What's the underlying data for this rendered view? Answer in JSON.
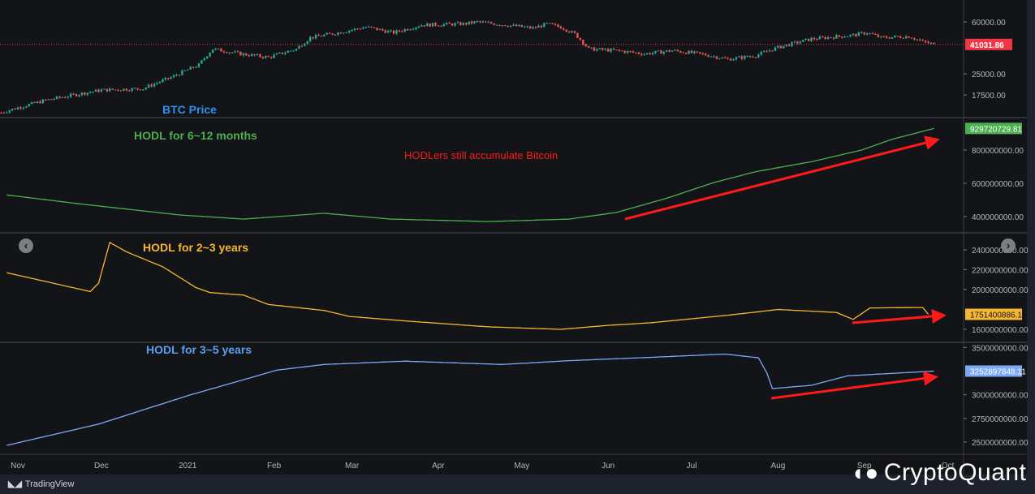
{
  "chart_data": [
    {
      "type": "candlestick",
      "name": "BTC Price",
      "title": "BTC Price",
      "scale": "log",
      "yticks": [
        "60000.00",
        "25000.00",
        "17500.00"
      ],
      "ytick_values": [
        60000,
        25000,
        17500
      ],
      "last_value": "41031.86",
      "last": 41031.86,
      "x_days": [
        -6,
        10,
        30,
        45,
        55,
        65,
        70,
        80,
        90,
        100,
        105,
        115,
        125,
        135,
        145,
        160,
        165,
        175,
        185,
        190,
        195,
        200,
        205,
        215,
        225,
        235,
        245,
        255,
        265,
        273,
        285,
        300,
        305,
        310,
        320,
        325,
        329
      ],
      "values": [
        13000,
        16000,
        19000,
        19500,
        23500,
        29000,
        38000,
        35000,
        33000,
        38000,
        46000,
        50000,
        55000,
        50000,
        57000,
        58000,
        60000,
        57000,
        54000,
        58000,
        55000,
        49000,
        38000,
        37000,
        35000,
        37000,
        35000,
        32000,
        34000,
        39000,
        45000,
        48000,
        50000,
        46000,
        47000,
        43000,
        41032
      ],
      "color_up": "#26a69a",
      "color_down": "#ef5350"
    },
    {
      "type": "line",
      "name": "HODL for 6~12 months",
      "title": "HODL for 6~12 months",
      "annotation": "HODLers still accumulate Bitcoin",
      "yticks": [
        "800000000.00",
        "600000000.00",
        "400000000.00"
      ],
      "ytick_values": [
        800,
        600,
        400
      ],
      "unit": "millions",
      "last_value": "929720729.81",
      "color": "#4caf50",
      "x_days": [
        -4,
        23,
        58,
        81,
        110,
        134,
        169,
        198,
        215,
        233,
        250,
        265,
        285,
        303,
        314,
        329
      ],
      "values": [
        530,
        475,
        410,
        385,
        420,
        385,
        370,
        385,
        425,
        510,
        605,
        670,
        730,
        800,
        865,
        930
      ]
    },
    {
      "type": "line",
      "name": "HODL for 2~3 years",
      "title": "HODL for 2~3 years",
      "yticks": [
        "2400000000.00",
        "2200000000.00",
        "2000000000.00",
        "1600000000.00"
      ],
      "ytick_values": [
        2400,
        2200,
        2000,
        1600
      ],
      "unit": "millions",
      "last_value": "1751400886.12",
      "color": "#f5b731",
      "x_days": [
        -4,
        26,
        29,
        33,
        39,
        52,
        64,
        69,
        81,
        90,
        110,
        119,
        139,
        169,
        195,
        212,
        227,
        256,
        273,
        294,
        300,
        306,
        325,
        327
      ],
      "values": [
        2170,
        1980,
        2065,
        2475,
        2380,
        2230,
        2020,
        1970,
        1945,
        1850,
        1790,
        1730,
        1685,
        1625,
        1600,
        1640,
        1665,
        1745,
        1800,
        1770,
        1700,
        1815,
        1820,
        1751
      ]
    },
    {
      "type": "line",
      "name": "HODL for 3~5 years",
      "title": "HODL for 3~5 years",
      "yticks": [
        "3500000000.00",
        "3000000000.00",
        "2750000000.00",
        "2500000000.00"
      ],
      "ytick_values": [
        3500,
        3000,
        2750,
        2500
      ],
      "unit": "millions",
      "last_value": "3252897848.11",
      "color": "#7ea9f5",
      "x_days": [
        -4,
        29,
        61,
        93,
        110,
        139,
        174,
        198,
        227,
        254,
        266,
        269,
        271,
        285,
        298,
        329
      ],
      "values": [
        2465,
        2690,
        2990,
        3260,
        3320,
        3355,
        3320,
        3360,
        3395,
        3430,
        3390,
        3230,
        3065,
        3100,
        3200,
        3250
      ]
    }
  ],
  "x_axis": {
    "labels": [
      "Nov",
      "Dec",
      "2021",
      "Feb",
      "Mar",
      "Apr",
      "May",
      "Jun",
      "Jul",
      "Aug",
      "Sep",
      "Oct"
    ],
    "label_days": [
      0,
      30,
      61,
      92,
      120,
      151,
      181,
      212,
      242,
      273,
      304,
      334
    ]
  },
  "footer": {
    "tradingview": "TradingView",
    "watermark": "CryptoQuant"
  },
  "annotation_color": "#ff1a1a"
}
